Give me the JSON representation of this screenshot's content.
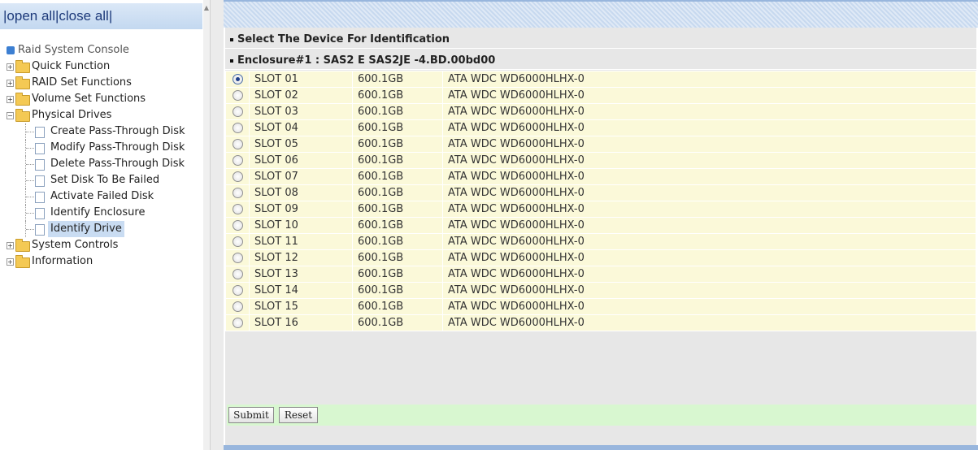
{
  "nav": {
    "open_all": "open all",
    "close_all": "close all",
    "root": "Raid System Console",
    "items": [
      {
        "label": "Quick Function"
      },
      {
        "label": "RAID Set Functions"
      },
      {
        "label": "Volume Set Functions"
      },
      {
        "label": "Physical Drives",
        "expanded": true
      }
    ],
    "children": [
      "Create Pass-Through Disk",
      "Modify Pass-Through Disk",
      "Delete Pass-Through Disk",
      "Set Disk To Be Failed",
      "Activate Failed Disk",
      "Identify Enclosure",
      "Identify Drive"
    ],
    "selected_child": "Identify Drive",
    "after_items": [
      {
        "label": "System Controls"
      },
      {
        "label": "Information"
      }
    ]
  },
  "main": {
    "header": "Select The Device For Identification",
    "enclosure": "Enclosure#1 : SAS2 E SAS2JE -4.BD.00bd00",
    "rows": [
      {
        "slot": "SLOT 01",
        "size": "600.1GB",
        "model": "ATA WDC WD6000HLHX-0",
        "selected": true
      },
      {
        "slot": "SLOT 02",
        "size": "600.1GB",
        "model": "ATA WDC WD6000HLHX-0",
        "selected": false
      },
      {
        "slot": "SLOT 03",
        "size": "600.1GB",
        "model": "ATA WDC WD6000HLHX-0",
        "selected": false
      },
      {
        "slot": "SLOT 04",
        "size": "600.1GB",
        "model": "ATA WDC WD6000HLHX-0",
        "selected": false
      },
      {
        "slot": "SLOT 05",
        "size": "600.1GB",
        "model": "ATA WDC WD6000HLHX-0",
        "selected": false
      },
      {
        "slot": "SLOT 06",
        "size": "600.1GB",
        "model": "ATA WDC WD6000HLHX-0",
        "selected": false
      },
      {
        "slot": "SLOT 07",
        "size": "600.1GB",
        "model": "ATA WDC WD6000HLHX-0",
        "selected": false
      },
      {
        "slot": "SLOT 08",
        "size": "600.1GB",
        "model": "ATA WDC WD6000HLHX-0",
        "selected": false
      },
      {
        "slot": "SLOT 09",
        "size": "600.1GB",
        "model": "ATA WDC WD6000HLHX-0",
        "selected": false
      },
      {
        "slot": "SLOT 10",
        "size": "600.1GB",
        "model": "ATA WDC WD6000HLHX-0",
        "selected": false
      },
      {
        "slot": "SLOT 11",
        "size": "600.1GB",
        "model": "ATA WDC WD6000HLHX-0",
        "selected": false
      },
      {
        "slot": "SLOT 12",
        "size": "600.1GB",
        "model": "ATA WDC WD6000HLHX-0",
        "selected": false
      },
      {
        "slot": "SLOT 13",
        "size": "600.1GB",
        "model": "ATA WDC WD6000HLHX-0",
        "selected": false
      },
      {
        "slot": "SLOT 14",
        "size": "600.1GB",
        "model": "ATA WDC WD6000HLHX-0",
        "selected": false
      },
      {
        "slot": "SLOT 15",
        "size": "600.1GB",
        "model": "ATA WDC WD6000HLHX-0",
        "selected": false
      },
      {
        "slot": "SLOT 16",
        "size": "600.1GB",
        "model": "ATA WDC WD6000HLHX-0",
        "selected": false
      }
    ],
    "submit_label": "Submit",
    "reset_label": "Reset"
  },
  "colors": {
    "row_bg": "#fbf9d9",
    "button_bar_bg": "#d8f7d0",
    "nav_header_bg": "#c3d8f0",
    "folder": "#f4c954"
  },
  "icons": {
    "tree_folder": "folder-icon",
    "tree_page": "page-icon",
    "root": "raid-console-icon",
    "expander_plus": "plus-expander-icon",
    "expander_minus": "minus-expander-icon"
  }
}
